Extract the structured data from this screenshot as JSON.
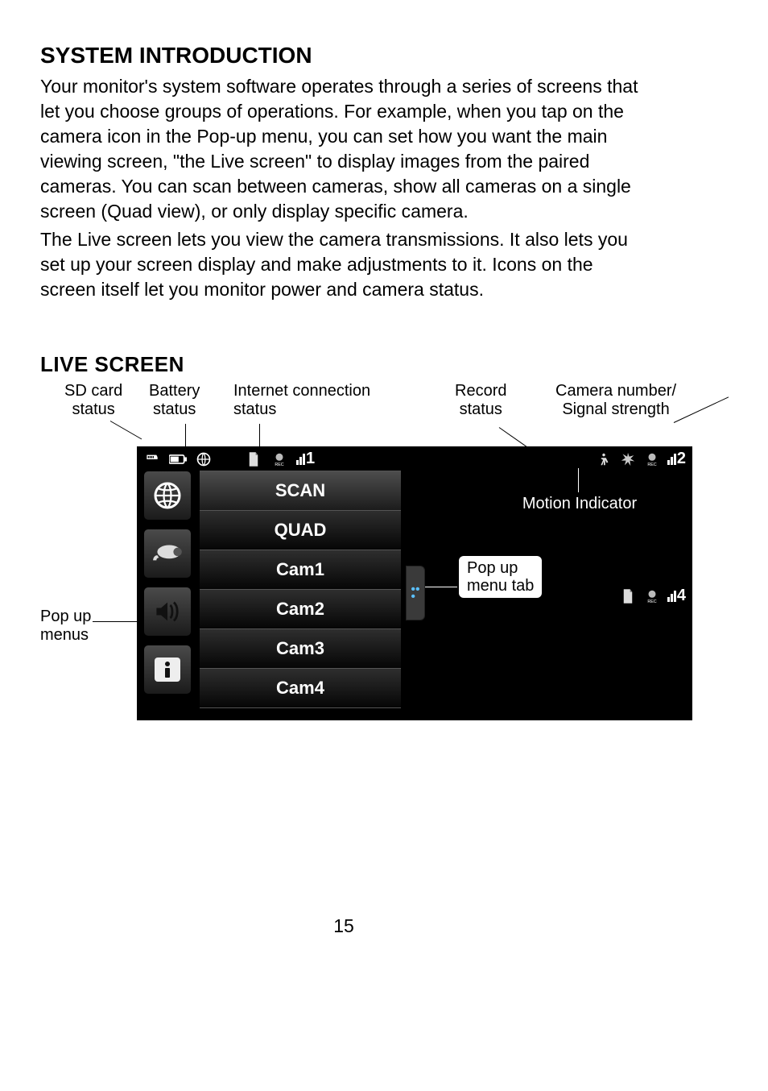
{
  "heading": "SYSTEM INTRODUCTION",
  "para1": "Your monitor's system software operates through a series of screens that let you choose groups of operations. For example, when you tap on the camera icon in the Pop-up menu, you can set how you want the main viewing screen, \"the Live screen\" to display images from the paired cameras. You can scan between cameras, show all cameras on a single screen (Quad view), or only display specific camera.",
  "para2": "The Live screen lets you view the camera transmissions. It also lets you set up your screen display and make adjustments to it. Icons on the screen itself let you monitor power and camera status.",
  "subheading": "LIVE SCREEN",
  "callouts": {
    "sd": "SD card\nstatus",
    "batt": "Battery\nstatus",
    "net": "Internet connection\nstatus",
    "rec": "Record\nstatus",
    "sig": "Camera number/\nSignal strength",
    "motion": "Motion Indicator",
    "popup_tab": "Pop up\nmenu tab",
    "popup_menus": "Pop up\nmenus"
  },
  "menu": {
    "items": [
      "SCAN",
      "QUAD",
      "Cam1",
      "Cam2",
      "Cam3",
      "Cam4"
    ]
  },
  "signals": {
    "q1": "1",
    "q2": "2",
    "q4": "4"
  },
  "page": "15"
}
